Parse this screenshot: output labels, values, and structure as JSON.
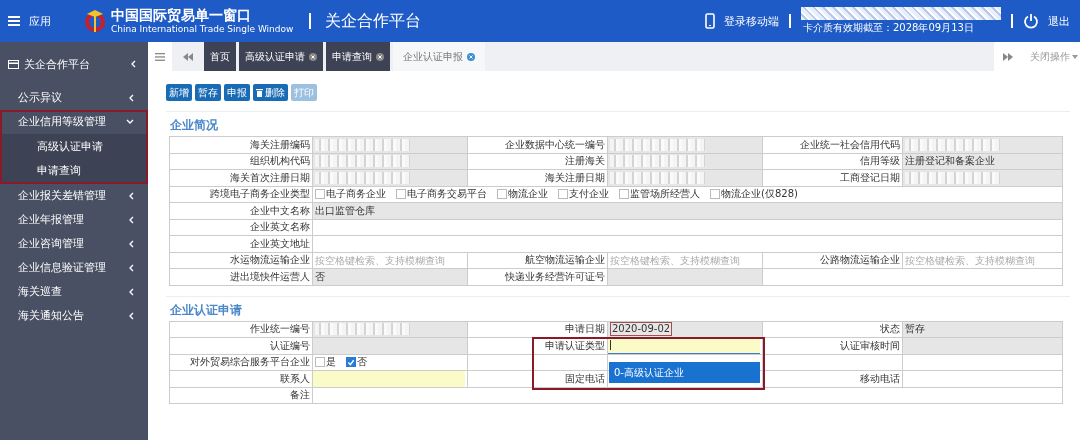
{
  "header": {
    "menu_label": "应用",
    "brand_title": "中国国际贸易单一窗口",
    "brand_subtitle": "China International Trade Single Window",
    "platform": "关企合作平台",
    "mobile_login": "登录移动端",
    "card_expiry": "卡介质有效期截至：2028年09月13日",
    "logout": "退出"
  },
  "sidebar": {
    "title": "关企合作平台",
    "items": [
      {
        "label": "公示异议",
        "expanded": false,
        "highlighted": false
      },
      {
        "label": "企业信用等级管理",
        "expanded": true,
        "highlighted": true,
        "children": [
          {
            "label": "高级认证申请"
          },
          {
            "label": "申请查询"
          }
        ]
      },
      {
        "label": "企业报关差错管理",
        "expanded": false,
        "highlighted": false
      },
      {
        "label": "企业年报管理",
        "expanded": false,
        "highlighted": false
      },
      {
        "label": "企业咨询管理",
        "expanded": false,
        "highlighted": false
      },
      {
        "label": "企业信息验证管理",
        "expanded": false,
        "highlighted": false
      },
      {
        "label": "海关巡查",
        "expanded": false,
        "highlighted": false
      },
      {
        "label": "海关通知公告",
        "expanded": false,
        "highlighted": false
      }
    ]
  },
  "tabs": [
    {
      "label": "首页",
      "selected": false,
      "closable": false
    },
    {
      "label": "高级认证申请",
      "selected": false,
      "closable": true
    },
    {
      "label": "申请查询",
      "selected": false,
      "closable": true
    },
    {
      "label": "企业认证申报",
      "selected": true,
      "closable": true
    }
  ],
  "close_menu": "关闭操作",
  "toolbar": [
    {
      "label": "新增",
      "disabled": false,
      "icon": false
    },
    {
      "label": "暂存",
      "disabled": false,
      "icon": false
    },
    {
      "label": "申报",
      "disabled": false,
      "icon": false
    },
    {
      "label": "删除",
      "disabled": false,
      "icon": true
    },
    {
      "label": "打印",
      "disabled": true,
      "icon": false
    }
  ],
  "sections": [
    {
      "title": "企业简况",
      "rows": [
        [
          {
            "kind": "label",
            "text": "海关注册编码"
          },
          {
            "kind": "value",
            "readonly": true,
            "redacted": true
          },
          {
            "kind": "label",
            "text": "企业数据中心统一编号"
          },
          {
            "kind": "value",
            "readonly": true,
            "redacted": true
          },
          {
            "kind": "label",
            "text": "企业统一社会信用代码"
          },
          {
            "kind": "value",
            "readonly": true,
            "redacted": true
          }
        ],
        [
          {
            "kind": "label",
            "text": "组织机构代码"
          },
          {
            "kind": "value",
            "readonly": true,
            "redacted": true
          },
          {
            "kind": "label",
            "text": "注册海关"
          },
          {
            "kind": "value",
            "readonly": true,
            "redacted": true
          },
          {
            "kind": "label",
            "text": "信用等级"
          },
          {
            "kind": "value",
            "readonly": true,
            "text": "注册登记和备案企业"
          }
        ],
        [
          {
            "kind": "label",
            "text": "海关首次注册日期"
          },
          {
            "kind": "value",
            "readonly": true,
            "redacted": true
          },
          {
            "kind": "label",
            "text": "海关注册日期"
          },
          {
            "kind": "value",
            "readonly": true,
            "redacted": true
          },
          {
            "kind": "label",
            "text": "工商登记日期"
          },
          {
            "kind": "value",
            "readonly": true,
            "redacted": true
          }
        ],
        [
          {
            "kind": "label",
            "text": "跨境电子商务企业类型"
          },
          {
            "kind": "checks",
            "wide": true,
            "options": [
              {
                "label": "电子商务企业",
                "checked": false
              },
              {
                "label": "电子商务交易平台",
                "checked": false
              },
              {
                "label": "物流企业",
                "checked": false
              },
              {
                "label": "支付企业",
                "checked": false
              },
              {
                "label": "监管场所经营人",
                "checked": false
              },
              {
                "label": "物流企业(仅828)",
                "checked": false
              }
            ]
          }
        ],
        [
          {
            "kind": "label",
            "text": "企业中文名称"
          },
          {
            "kind": "value",
            "readonly": true,
            "wide": true,
            "text": "出口监管仓库"
          }
        ],
        [
          {
            "kind": "label",
            "text": "企业英文名称"
          },
          {
            "kind": "value",
            "readonly": false,
            "wide": true
          }
        ],
        [
          {
            "kind": "label",
            "text": "企业英文地址"
          },
          {
            "kind": "value",
            "readonly": false,
            "wide": true
          }
        ],
        [
          {
            "kind": "label",
            "text": "水运物流运输企业"
          },
          {
            "kind": "value",
            "readonly": false,
            "placeholder": "按空格键检索、支持模糊查询"
          },
          {
            "kind": "label",
            "text": "航空物流运输企业"
          },
          {
            "kind": "value",
            "readonly": false,
            "placeholder": "按空格键检索、支持模糊查询"
          },
          {
            "kind": "label",
            "text": "公路物流运输企业"
          },
          {
            "kind": "value",
            "readonly": false,
            "placeholder": "按空格键检索、支持模糊查询"
          }
        ],
        [
          {
            "kind": "label",
            "text": "进出境快件运营人"
          },
          {
            "kind": "value",
            "readonly": true,
            "text": "否"
          },
          {
            "kind": "label",
            "text": "快递业务经营许可证号"
          },
          {
            "kind": "value",
            "readonly": true
          },
          {
            "kind": "value",
            "readonly": false,
            "wide": true
          }
        ]
      ]
    },
    {
      "title": "企业认证申请",
      "rows": [
        [
          {
            "kind": "label",
            "text": "作业统一编号"
          },
          {
            "kind": "value",
            "readonly": true,
            "redacted": true
          },
          {
            "kind": "label",
            "text": "申请日期"
          },
          {
            "kind": "value",
            "readonly": true,
            "text": "2020-09-02",
            "outlined": true
          },
          {
            "kind": "label",
            "text": "状态"
          },
          {
            "kind": "value",
            "readonly": true,
            "text": "暂存"
          }
        ],
        [
          {
            "kind": "label",
            "text": "认证编号"
          },
          {
            "kind": "value",
            "readonly": true
          },
          {
            "kind": "label",
            "text": "申请认证类型",
            "highlighted": true
          },
          {
            "kind": "input",
            "required": true,
            "focused": true
          },
          {
            "kind": "label",
            "text": "认证审核时间"
          },
          {
            "kind": "value",
            "readonly": true
          }
        ],
        [
          {
            "kind": "label",
            "text": "对外贸易综合服务平台企业"
          },
          {
            "kind": "checks",
            "options": [
              {
                "label": "是",
                "checked": false
              },
              {
                "label": "否",
                "checked": true
              }
            ]
          },
          {
            "kind": "value",
            "readonly": false
          },
          {
            "kind": "value",
            "readonly": false
          },
          {
            "kind": "value",
            "readonly": false
          },
          {
            "kind": "value",
            "readonly": false
          }
        ],
        [
          {
            "kind": "label",
            "text": "联系人"
          },
          {
            "kind": "input",
            "required": true,
            "focused": false
          },
          {
            "kind": "label",
            "text": "固定电话"
          },
          {
            "kind": "value",
            "readonly": false
          },
          {
            "kind": "label",
            "text": "移动电话"
          },
          {
            "kind": "value",
            "readonly": false
          }
        ],
        [
          {
            "kind": "label",
            "text": "备注"
          },
          {
            "kind": "value",
            "readonly": false,
            "wide": true
          }
        ]
      ],
      "dropdown": {
        "options": [
          {
            "label": "0-高级认证企业",
            "selected": true
          }
        ]
      }
    }
  ]
}
